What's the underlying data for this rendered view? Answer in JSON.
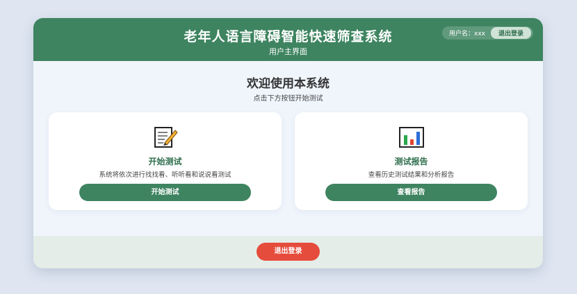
{
  "header": {
    "title": "老年人语言障碍智能快速筛查系统",
    "subtitle": "用户主界面",
    "username_label": "用户名：xxx",
    "logout_label": "退出登录"
  },
  "main": {
    "welcome": "欢迎使用本系统",
    "hint": "点击下方按钮开始测试",
    "cards": [
      {
        "icon": "memo-icon",
        "title": "开始测试",
        "description": "系统将依次进行找找看、听听看和说说看测试",
        "button_label": "开始测试"
      },
      {
        "icon": "bar-chart-icon",
        "title": "测试报告",
        "description": "查看历史测试结果和分析报告",
        "button_label": "查看报告"
      }
    ]
  },
  "footer": {
    "logout_label": "退出登录"
  },
  "colors": {
    "primary_green": "#3e8460",
    "logout_red": "#e54c3c",
    "background": "#dfe6f2"
  }
}
